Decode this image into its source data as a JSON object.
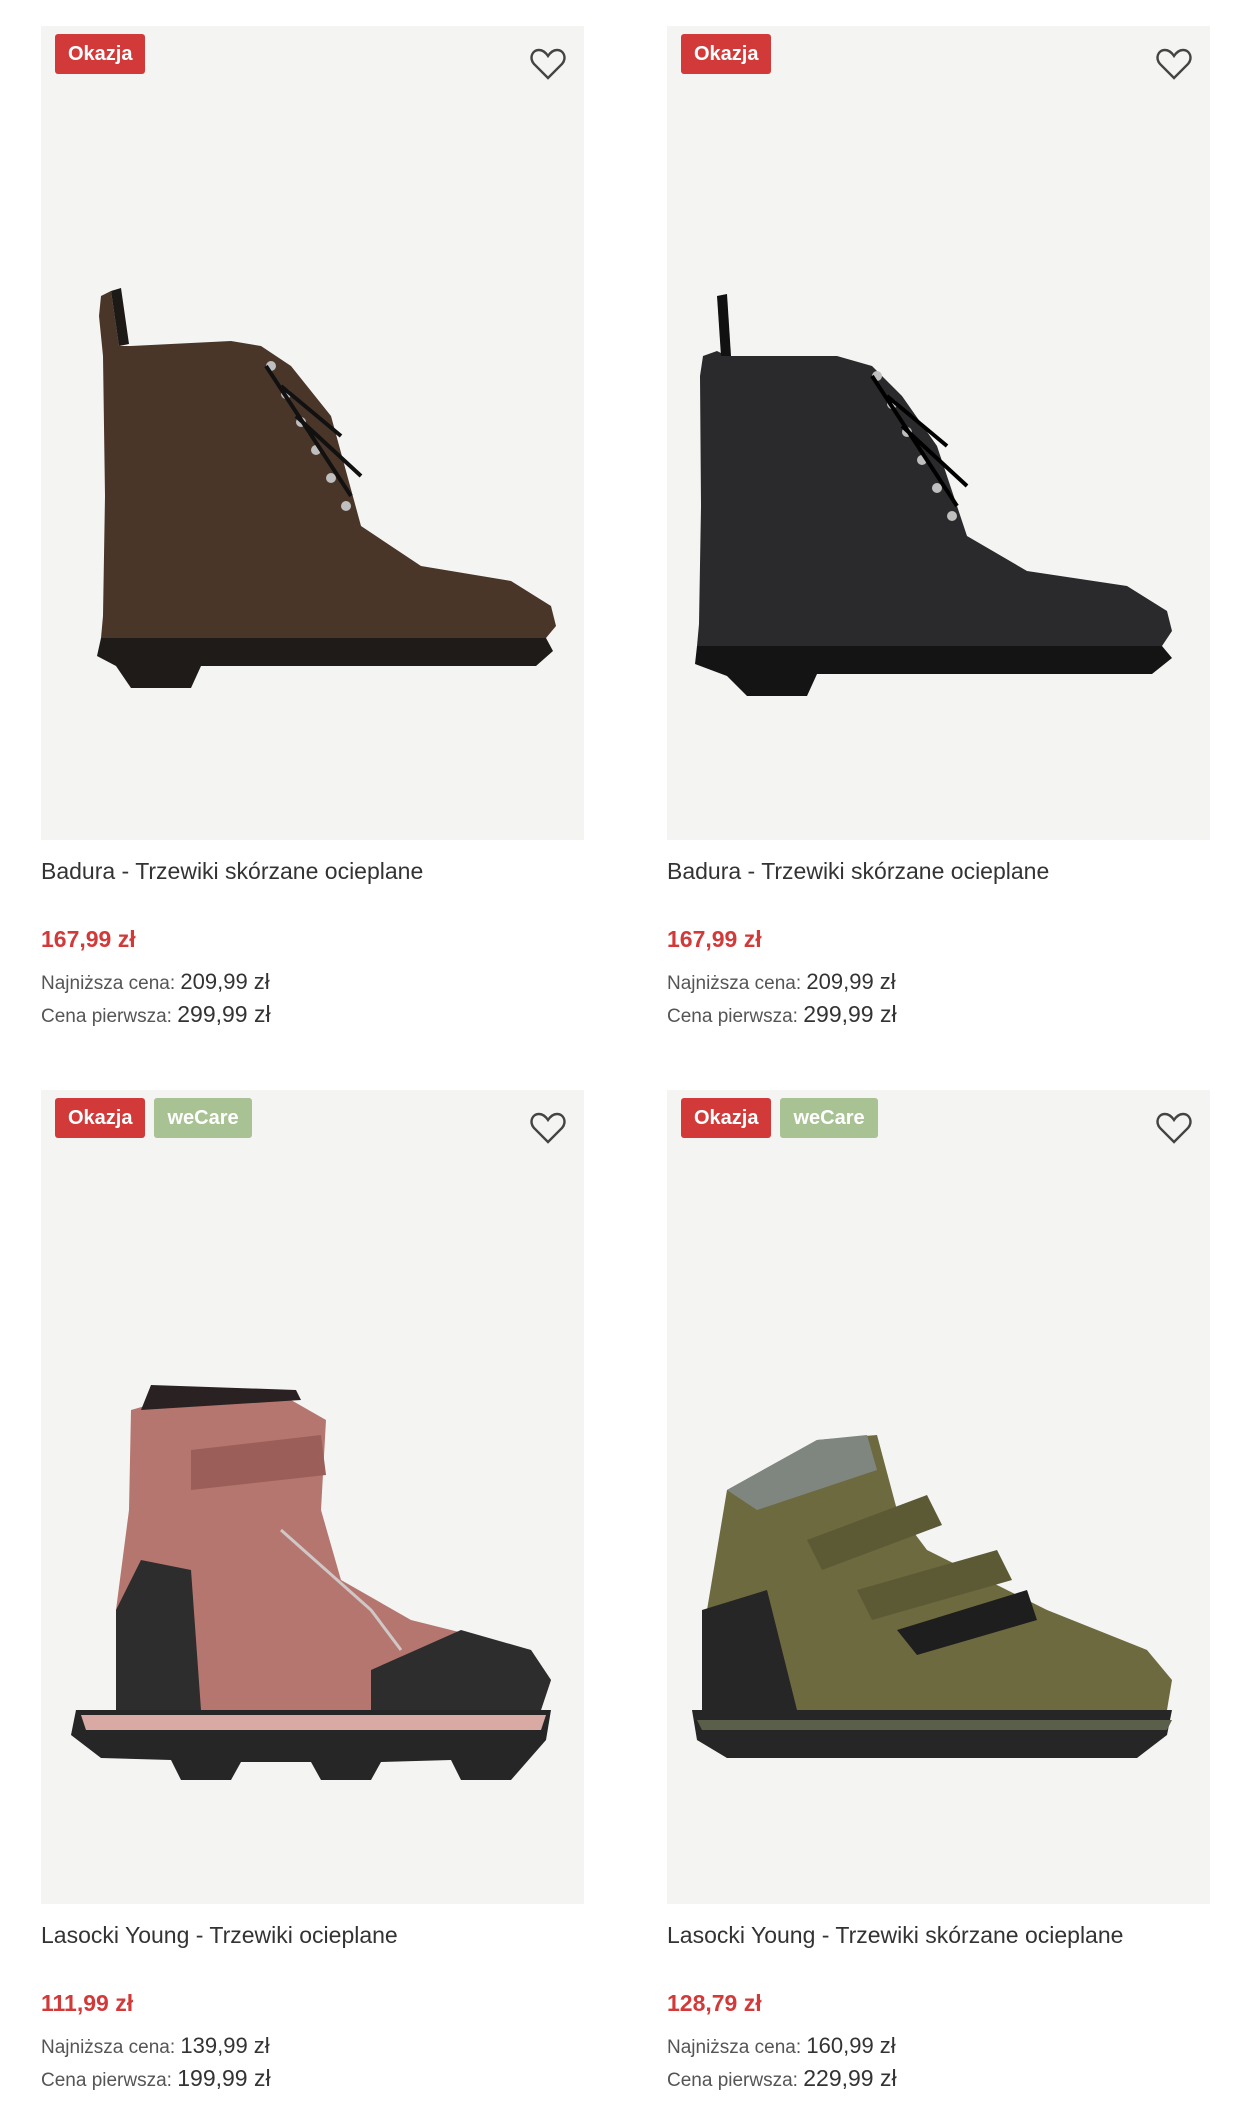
{
  "products": [
    {
      "title": "Badura - Trzewiki skórzane ocieplane",
      "price": "167,99 zł",
      "lowest_label": "Najniższa cena:",
      "lowest_value": "209,99 zł",
      "first_label": "Cena pierwsza:",
      "first_value": "299,99 zł",
      "badges": [
        "Okazja"
      ]
    },
    {
      "title": "Badura - Trzewiki skórzane ocieplane",
      "price": "167,99 zł",
      "lowest_label": "Najniższa cena:",
      "lowest_value": "209,99 zł",
      "first_label": "Cena pierwsza:",
      "first_value": "299,99 zł",
      "badges": [
        "Okazja"
      ]
    },
    {
      "title": "Lasocki Young - Trzewiki ocieplane",
      "price": "111,99 zł",
      "lowest_label": "Najniższa cena:",
      "lowest_value": "139,99 zł",
      "first_label": "Cena pierwsza:",
      "first_value": "199,99 zł",
      "badges": [
        "Okazja",
        "weCare"
      ]
    },
    {
      "title": "Lasocki Young - Trzewiki skórzane ocieplane",
      "price": "128,79 zł",
      "lowest_label": "Najniższa cena:",
      "lowest_value": "160,99 zł",
      "first_label": "Cena pierwsza:",
      "first_value": "229,99 zł",
      "badges": [
        "Okazja",
        "weCare"
      ]
    }
  ],
  "icons": {
    "favorite": "heart-outline-icon"
  },
  "colors": {
    "sale_red": "#d23a3a",
    "wecare_green": "#a9c294",
    "image_bg": "#f4f4f3"
  }
}
